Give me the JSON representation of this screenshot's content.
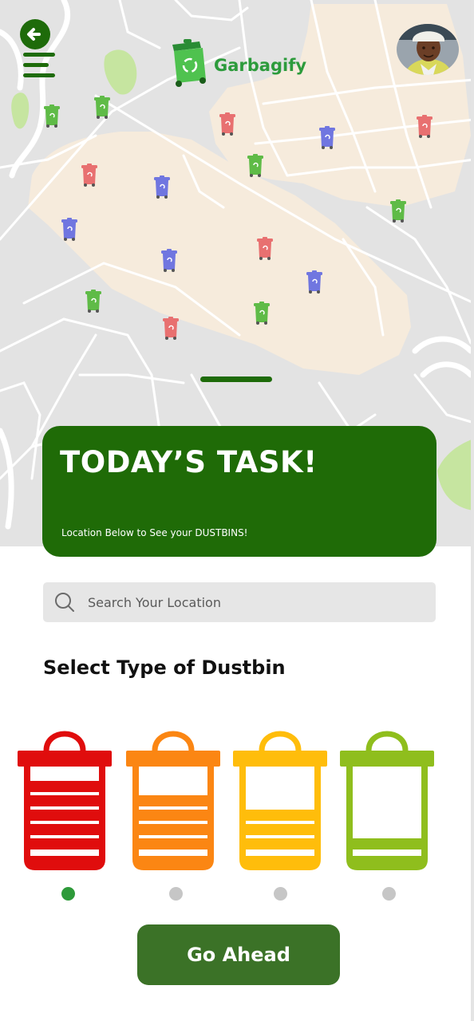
{
  "header": {
    "brand_name": "Garbagify",
    "back_icon": "arrow-left-icon",
    "menu_icon": "hamburger-menu-icon",
    "logo_icon": "recycle-bin-icon"
  },
  "map": {
    "marker_icon": "trash-bin-icon",
    "marker_colors": {
      "red": "#e87070",
      "green": "#5fbb47",
      "blue": "#7076e0"
    }
  },
  "task_card": {
    "title": "TODAY’S TASK!",
    "subtitle": "Location Below to See your DUSTBINS!"
  },
  "search": {
    "placeholder": "Search Your Location",
    "value": ""
  },
  "dustbin_section": {
    "title": "Select Type of Dustbin",
    "options": [
      {
        "name": "red",
        "color": "#e00d0d",
        "fill_level": 1.0,
        "selected": true
      },
      {
        "name": "orange",
        "color": "#fb8613",
        "fill_level": 0.75,
        "selected": false
      },
      {
        "name": "yellow",
        "color": "#ffbd0b",
        "fill_level": 0.5,
        "selected": false
      },
      {
        "name": "green",
        "color": "#8fbe1d",
        "fill_level": 0.25,
        "selected": false
      }
    ]
  },
  "actions": {
    "go_ahead": "Go Ahead"
  },
  "colors": {
    "primary_green": "#1f6b07",
    "button_green": "#3b7227",
    "brand_green": "#2d9b3c",
    "indicator_active": "#2e9a3a",
    "indicator_inactive": "#c6c6c6"
  }
}
